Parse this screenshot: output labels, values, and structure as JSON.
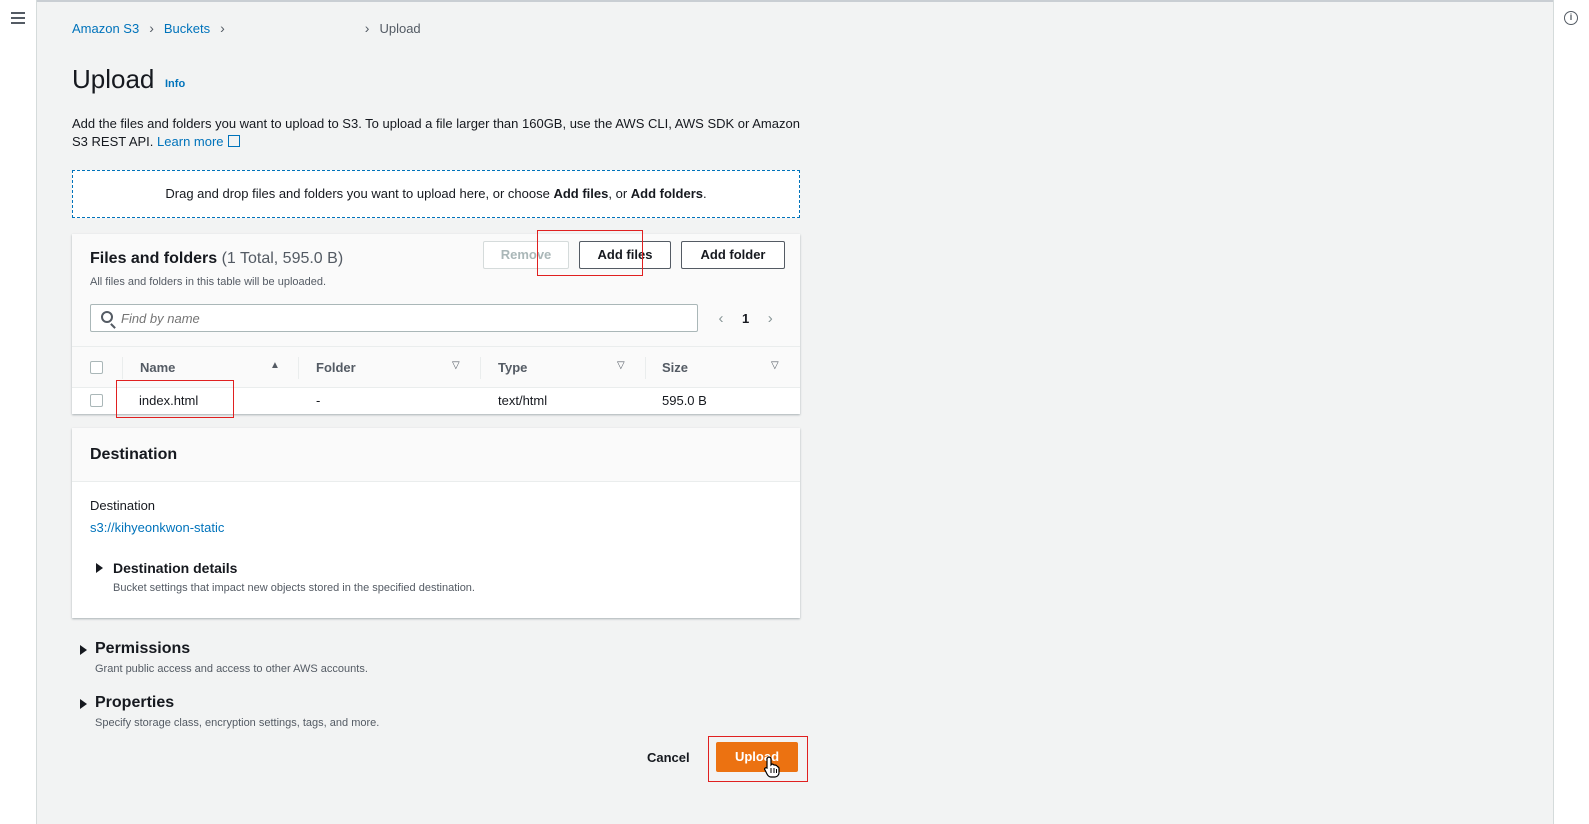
{
  "breadcrumb": {
    "s3": "Amazon S3",
    "buckets": "Buckets",
    "current": "Upload"
  },
  "page": {
    "title": "Upload",
    "info": "Info",
    "description": "Add the files and folders you want to upload to S3. To upload a file larger than 160GB, use the AWS CLI, AWS SDK or Amazon S3 REST API.",
    "learn_more": "Learn more"
  },
  "dropzone": {
    "text_before": "Drag and drop files and folders you want to upload here, or choose ",
    "add_files": "Add files",
    "separator": ", or ",
    "add_folders": "Add folders",
    "end": "."
  },
  "files": {
    "title": "Files and folders",
    "count": "(1 Total, 595.0 B)",
    "subtitle": "All files and folders in this table will be uploaded.",
    "remove_label": "Remove",
    "add_files_label": "Add files",
    "add_folder_label": "Add folder",
    "search_placeholder": "Find by name",
    "page": "1",
    "columns": [
      "Name",
      "Folder",
      "Type",
      "Size"
    ],
    "rows": [
      {
        "name": "index.html",
        "folder": "-",
        "type": "text/html",
        "size": "595.0 B"
      }
    ]
  },
  "destination": {
    "title": "Destination",
    "label": "Destination",
    "link": "s3://kihyeonkwon-static",
    "details_title": "Destination details",
    "details_sub": "Bucket settings that impact new objects stored in the specified destination."
  },
  "permissions": {
    "title": "Permissions",
    "sub": "Grant public access and access to other AWS accounts."
  },
  "properties": {
    "title": "Properties",
    "sub": "Specify storage class, encryption settings, tags, and more."
  },
  "actions": {
    "cancel": "Cancel",
    "upload": "Upload"
  },
  "colors": {
    "link": "#0073bb",
    "primary": "#ec7211",
    "highlight": "#e02020"
  }
}
